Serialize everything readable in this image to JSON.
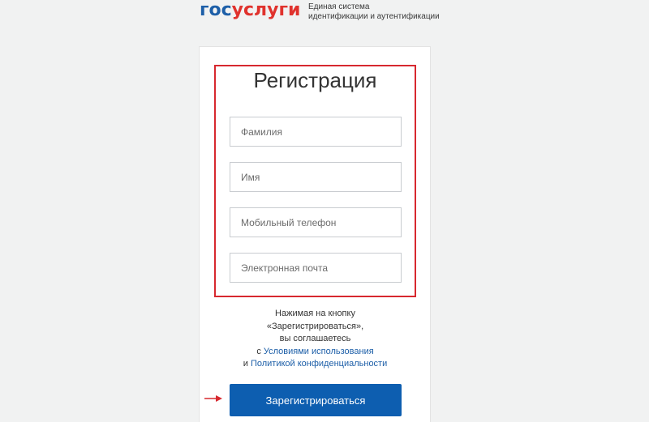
{
  "header": {
    "logo_part1": "гос",
    "logo_part2": "услуги",
    "caption_line1": "Единая система",
    "caption_line2": "идентификации и аутентификации"
  },
  "form": {
    "title": "Регистрация",
    "fields": [
      {
        "placeholder": "Фамилия",
        "value": ""
      },
      {
        "placeholder": "Имя",
        "value": ""
      },
      {
        "placeholder": "Мобильный телефон",
        "value": ""
      },
      {
        "placeholder": "Электронная почта",
        "value": ""
      }
    ],
    "terms": {
      "line1": "Нажимая на кнопку",
      "line2": "«Зарегистрироваться»,",
      "line3": "вы соглашаетесь",
      "line4_prefix": "с ",
      "terms_link": "Условиями использования",
      "line5_prefix": "и ",
      "privacy_link": "Политикой конфиденциальности"
    },
    "submit_label": "Зарегистрироваться"
  },
  "colors": {
    "brand_blue": "#0d5eb0",
    "brand_red": "#e0322d",
    "highlight_red": "#d7282f"
  }
}
